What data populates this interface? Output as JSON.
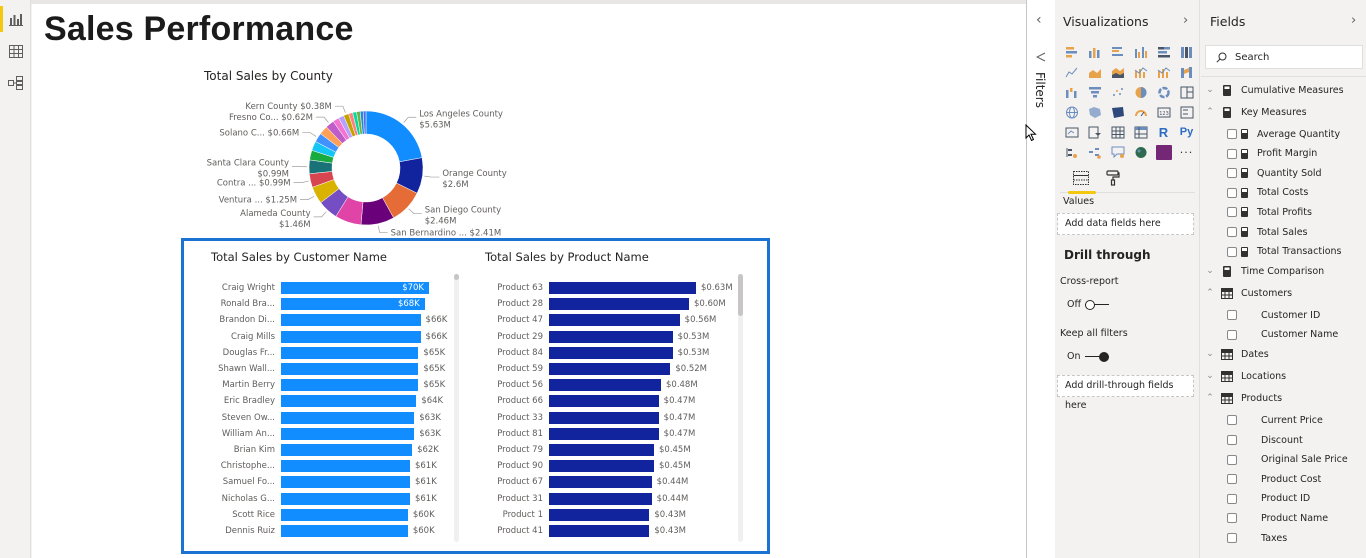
{
  "left_nav": {
    "items": [
      {
        "name": "report-view",
        "icon": "bar-chart-icon",
        "active": true
      },
      {
        "name": "data-view",
        "icon": "table-grid-icon",
        "active": false
      },
      {
        "name": "model-view",
        "icon": "model-icon",
        "active": false
      }
    ]
  },
  "page": {
    "title": "Sales Performance"
  },
  "colors": {
    "customer_bar": "#118dff",
    "product_bar": "#12239e",
    "selection_border": "#1a73d1",
    "accent_yellow": "#f2c811"
  },
  "chart_data": [
    {
      "type": "pie",
      "variant": "donut",
      "title": "Total Sales by County",
      "slices": [
        {
          "label": "Los Angeles County",
          "value": 5.63,
          "display": "$5.63M",
          "color": "#118dff"
        },
        {
          "label": "Orange County",
          "value": 2.6,
          "display": "$2.6M",
          "color": "#12239e"
        },
        {
          "label": "San Diego County",
          "value": 2.46,
          "display": "$2.46M",
          "color": "#e66c37"
        },
        {
          "label": "San Bernardino ...",
          "value": 2.41,
          "display": "$2.41M",
          "color": "#6b007b"
        },
        {
          "label": "",
          "value": 1.9,
          "display": "",
          "color": "#e044a7"
        },
        {
          "label": "Alameda County",
          "value": 1.46,
          "display": "$1.46M",
          "color": "#744ec2"
        },
        {
          "label": "Ventura ...",
          "value": 1.25,
          "display": "$1.25M",
          "color": "#d9b300"
        },
        {
          "label": "Contra ...",
          "value": 0.99,
          "display": "$0.99M",
          "color": "#d64550"
        },
        {
          "label": "Santa Clara County",
          "value": 0.99,
          "display": "$0.99M",
          "color": "#197278"
        },
        {
          "label": "",
          "value": 0.7,
          "display": "",
          "color": "#1aab40"
        },
        {
          "label": "",
          "value": 0.68,
          "display": "",
          "color": "#15c6f4"
        },
        {
          "label": "Solano C...",
          "value": 0.66,
          "display": "$0.66M",
          "color": "#4092ff"
        },
        {
          "label": "",
          "value": 0.64,
          "display": "",
          "color": "#ffa058"
        },
        {
          "label": "Fresno Co...",
          "value": 0.62,
          "display": "$0.62M",
          "color": "#be5dc9"
        },
        {
          "label": "",
          "value": 0.45,
          "display": "",
          "color": "#f472d0"
        },
        {
          "label": "",
          "value": 0.4,
          "display": "",
          "color": "#b5a1ff"
        },
        {
          "label": "Kern County",
          "value": 0.38,
          "display": "$0.38M",
          "color": "#c4a200"
        },
        {
          "label": "",
          "value": 0.3,
          "display": "",
          "color": "#ff8080"
        },
        {
          "label": "",
          "value": 0.28,
          "display": "",
          "color": "#00db9e"
        },
        {
          "label": "",
          "value": 0.26,
          "display": "",
          "color": "#72b043"
        },
        {
          "label": "",
          "value": 0.22,
          "display": "",
          "color": "#1b8ede"
        },
        {
          "label": "",
          "value": 0.2,
          "display": "",
          "color": "#4f6bed"
        }
      ]
    },
    {
      "type": "bar",
      "orientation": "horizontal",
      "title": "Total Sales by Customer Name",
      "categories": [
        "Craig Wright",
        "Ronald Bra...",
        "Brandon Di...",
        "Craig Mills",
        "Douglas Fr...",
        "Shawn Wall...",
        "Martin Berry",
        "Eric Bradley",
        "Steven Ow...",
        "William An...",
        "Brian Kim",
        "Christophe...",
        "Samuel Fo...",
        "Nicholas G...",
        "Scott Rice",
        "Dennis Ruiz"
      ],
      "values": [
        70,
        68,
        66,
        66,
        65,
        65,
        65,
        64,
        63,
        63,
        62,
        61,
        61,
        61,
        60,
        60
      ],
      "labels": [
        "$70K",
        "$68K",
        "$66K",
        "$66K",
        "$65K",
        "$65K",
        "$65K",
        "$64K",
        "$63K",
        "$63K",
        "$62K",
        "$61K",
        "$61K",
        "$61K",
        "$60K",
        "$60K"
      ],
      "unit": "K USD",
      "xlim": [
        0,
        70
      ]
    },
    {
      "type": "bar",
      "orientation": "horizontal",
      "title": "Total Sales by Product Name",
      "categories": [
        "Product 63",
        "Product 28",
        "Product 47",
        "Product 29",
        "Product 84",
        "Product 59",
        "Product 56",
        "Product 66",
        "Product 33",
        "Product 81",
        "Product 79",
        "Product 90",
        "Product 67",
        "Product 31",
        "Product 1",
        "Product 41"
      ],
      "values": [
        0.63,
        0.6,
        0.56,
        0.53,
        0.53,
        0.52,
        0.48,
        0.47,
        0.47,
        0.47,
        0.45,
        0.45,
        0.44,
        0.44,
        0.43,
        0.43
      ],
      "labels": [
        "$0.63M",
        "$0.60M",
        "$0.56M",
        "$0.53M",
        "$0.53M",
        "$0.52M",
        "$0.48M",
        "$0.47M",
        "$0.47M",
        "$0.47M",
        "$0.45M",
        "$0.45M",
        "$0.44M",
        "$0.44M",
        "$0.43M",
        "$0.43M"
      ],
      "unit": "M USD",
      "xlim": [
        0,
        0.63
      ]
    }
  ],
  "filters": {
    "label": "Filters",
    "collapse_icon": "chevron-left-icon",
    "funnel_icon": "filter-icon"
  },
  "visualizations": {
    "title": "Visualizations",
    "icons": [
      "stacked-bar-chart",
      "stacked-column-chart",
      "clustered-bar-chart",
      "clustered-column-chart",
      "100-stacked-bar-chart",
      "100-stacked-column-chart",
      "line-chart",
      "area-chart",
      "stacked-area-chart",
      "line-and-stacked-column-chart",
      "line-and-clustered-column-chart",
      "ribbon-chart",
      "waterfall-chart",
      "funnel-chart",
      "scatter-chart",
      "pie-chart",
      "donut-chart",
      "treemap",
      "map",
      "filled-map",
      "shape-map",
      "gauge",
      "card",
      "multi-row-card",
      "kpi",
      "slicer",
      "table",
      "matrix",
      "r-script-visual",
      "python-visual",
      "key-influencers",
      "decomposition-tree",
      "qa",
      "arcgis-map",
      "power-apps",
      "more-visuals"
    ],
    "tabs": [
      "fields-tab",
      "format-tab"
    ],
    "values_label": "Values",
    "values_dropzone": "Add data fields here",
    "drill_through_title": "Drill through",
    "cross_report_label": "Cross-report",
    "cross_report_state": "Off",
    "keep_filters_label": "Keep all filters",
    "keep_filters_state": "On",
    "drill_dropzone": "Add drill-through fields here"
  },
  "fields": {
    "title": "Fields",
    "search_placeholder": "Search",
    "items": [
      {
        "kind": "table",
        "label": "Cumulative Measures",
        "expanded": false,
        "icon": "calculator-icon"
      },
      {
        "kind": "table",
        "label": "Key Measures",
        "expanded": true,
        "icon": "calculator-icon"
      },
      {
        "kind": "measure",
        "label": "Average Quantity"
      },
      {
        "kind": "measure",
        "label": "Profit Margin"
      },
      {
        "kind": "measure",
        "label": "Quantity Sold"
      },
      {
        "kind": "measure",
        "label": "Total Costs"
      },
      {
        "kind": "measure",
        "label": "Total Profits"
      },
      {
        "kind": "measure",
        "label": "Total Sales"
      },
      {
        "kind": "measure",
        "label": "Total Transactions"
      },
      {
        "kind": "table",
        "label": "Time Comparison",
        "expanded": false,
        "icon": "calculator-icon"
      },
      {
        "kind": "table",
        "label": "Customers",
        "expanded": true,
        "icon": "table-icon"
      },
      {
        "kind": "column",
        "label": "Customer ID"
      },
      {
        "kind": "column",
        "label": "Customer Name"
      },
      {
        "kind": "table",
        "label": "Dates",
        "expanded": false,
        "icon": "table-icon"
      },
      {
        "kind": "table",
        "label": "Locations",
        "expanded": false,
        "icon": "table-icon"
      },
      {
        "kind": "table",
        "label": "Products",
        "expanded": true,
        "icon": "table-icon"
      },
      {
        "kind": "column",
        "label": "Current Price"
      },
      {
        "kind": "column",
        "label": "Discount"
      },
      {
        "kind": "column",
        "label": "Original Sale Price"
      },
      {
        "kind": "column",
        "label": "Product Cost"
      },
      {
        "kind": "column",
        "label": "Product ID"
      },
      {
        "kind": "column",
        "label": "Product Name"
      },
      {
        "kind": "column",
        "label": "Taxes"
      }
    ]
  }
}
